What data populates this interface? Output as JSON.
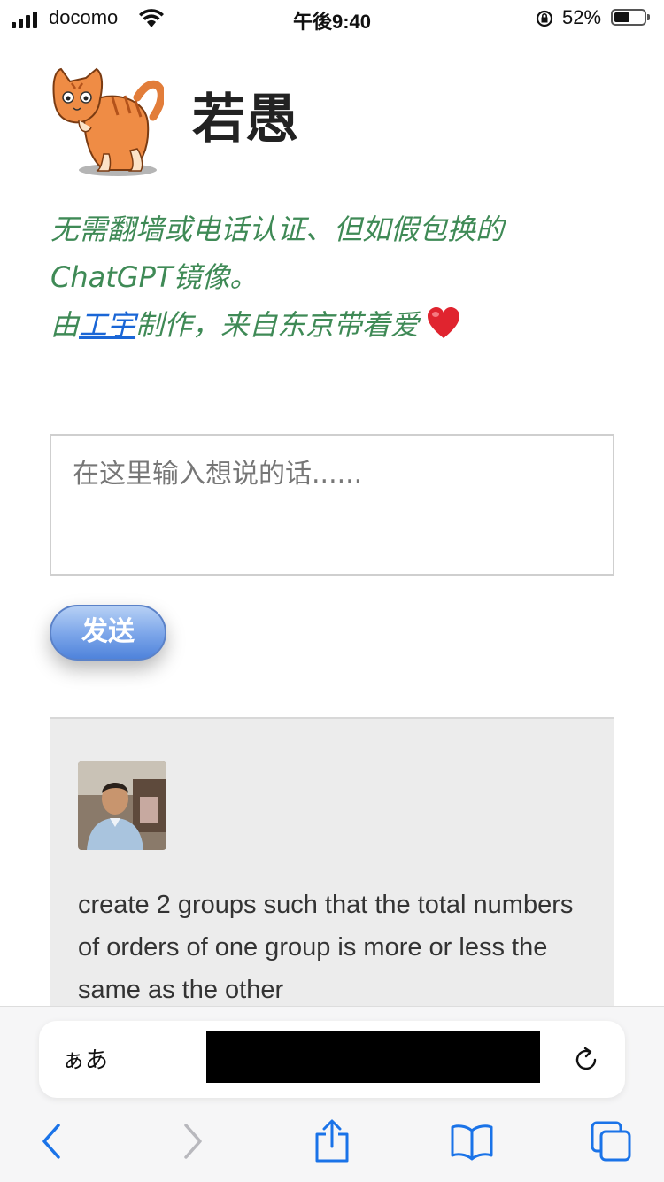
{
  "status_bar": {
    "carrier": "docomo",
    "time": "午後9:40",
    "battery_percent": "52%",
    "battery_level": 0.52
  },
  "header": {
    "title": "若愚",
    "tagline_line1": "无需翻墙或电话认证、但如假包换的",
    "tagline_line2": "ChatGPT镜像。",
    "tagline_prefix": "由",
    "author_link": "工宇",
    "tagline_suffix": "制作，来自东京带着爱"
  },
  "composer": {
    "placeholder": "在这里输入想说的话......",
    "send_label": "发送"
  },
  "messages": [
    {
      "text": "create 2 groups such that the total numbers of orders of one group is more or less the same as the other"
    }
  ],
  "browser": {
    "text_size_label": "ぁあ"
  },
  "colors": {
    "tagline": "#3f8a56",
    "link": "#1a66d6",
    "send_button": "#6f9ae3",
    "card_background": "#ececec"
  }
}
